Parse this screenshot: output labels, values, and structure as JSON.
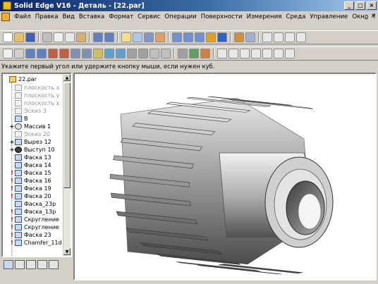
{
  "window": {
    "title": "Solid Edge V16 - Деталь - [22.par]",
    "controls": [
      "_",
      "□",
      "×"
    ]
  },
  "menubar": {
    "items": [
      "Файл",
      "Правка",
      "Вид",
      "Вставка",
      "Формат",
      "Сервис",
      "Операции",
      "Поверхности",
      "Измерения",
      "Среда",
      "Управление",
      "Окно",
      "?"
    ],
    "doc_controls": [
      "_",
      "×"
    ]
  },
  "prompt": "Укажите первый угол или удержите кнопку мыши, если нужен куб.",
  "pathfinder": {
    "items": [
      {
        "label": "22.par",
        "state": "normal",
        "mark": ""
      },
      {
        "label": "плоскость x",
        "state": "dim",
        "mark": ""
      },
      {
        "label": "плоскость y",
        "state": "dim",
        "mark": ""
      },
      {
        "label": "плоскость x",
        "state": "dim",
        "mark": ""
      },
      {
        "label": "Эскиз 3",
        "state": "dim",
        "mark": ""
      },
      {
        "label": "В",
        "state": "normal",
        "mark": ""
      },
      {
        "label": "Массив 1",
        "state": "normal",
        "mark": "+"
      },
      {
        "label": "Эскиз 20",
        "state": "dim",
        "mark": ""
      },
      {
        "label": "Вырез 12",
        "state": "normal",
        "mark": "+"
      },
      {
        "label": "Выступ 10",
        "state": "normal",
        "mark": "+"
      },
      {
        "label": "Фаска 13",
        "state": "normal",
        "mark": ""
      },
      {
        "label": "Фаска 14",
        "state": "normal",
        "mark": ""
      },
      {
        "label": "Фаска 15",
        "state": "normal",
        "mark": "!"
      },
      {
        "label": "Фаска 16",
        "state": "normal",
        "mark": "!"
      },
      {
        "label": "Фаска 19",
        "state": "normal",
        "mark": "!"
      },
      {
        "label": "Фаска 20",
        "state": "normal",
        "mark": "!"
      },
      {
        "label": "Фаска_23р",
        "state": "normal",
        "mark": ""
      },
      {
        "label": "Фаска_13р",
        "state": "normal",
        "mark": "!"
      },
      {
        "label": "Скругление",
        "state": "normal",
        "mark": "!"
      },
      {
        "label": "Скругление",
        "state": "normal",
        "mark": "!"
      },
      {
        "label": "Фаска 23",
        "state": "normal",
        "mark": "!"
      },
      {
        "label": "Chamfer_11d",
        "state": "normal",
        "mark": "!"
      }
    ]
  },
  "colors": {
    "title_start": "#0a246a",
    "title_end": "#a6caf0",
    "chrome": "#d4d0c8",
    "gear_face": "#d8d8d8",
    "gear_dark": "#4a4a4a"
  }
}
